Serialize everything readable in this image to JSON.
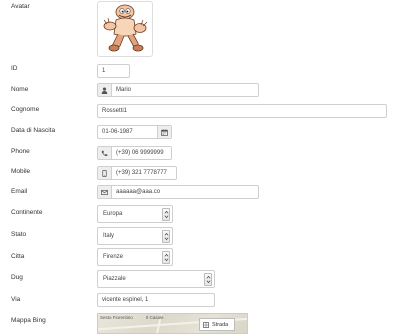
{
  "labels": {
    "avatar": "Avatar",
    "id": "ID",
    "nome": "Nome",
    "cognome": "Cognome",
    "data_nascita": "Data di Nascita",
    "phone": "Phone",
    "mobile": "Mobile",
    "email": "Email",
    "continente": "Continente",
    "stato": "Stato",
    "citta": "Citta",
    "dug": "Dug",
    "via": "Via",
    "mappa": "Mappa Bing"
  },
  "values": {
    "id": "1",
    "nome": "Mario",
    "cognome": "Rossetti1",
    "data_nascita": "01-06-1987",
    "phone": "(+39) 06 9999999",
    "mobile": "(+39) 321 7778777",
    "email": "aaaaaa@aaa.co",
    "continente": "Europa",
    "stato": "Italy",
    "citta": "Firenze",
    "dug": "Piazzale",
    "via": "vicente espinel, 1"
  },
  "icons": {
    "nome": "user-icon",
    "data_nascita": "calendar-icon",
    "phone": "phone-icon",
    "mobile": "mobile-phone-icon",
    "email": "envelope-icon"
  },
  "map": {
    "place_1": "Sesto Fiorentino",
    "place_2": "Il Casale",
    "road_button": "Strada"
  }
}
